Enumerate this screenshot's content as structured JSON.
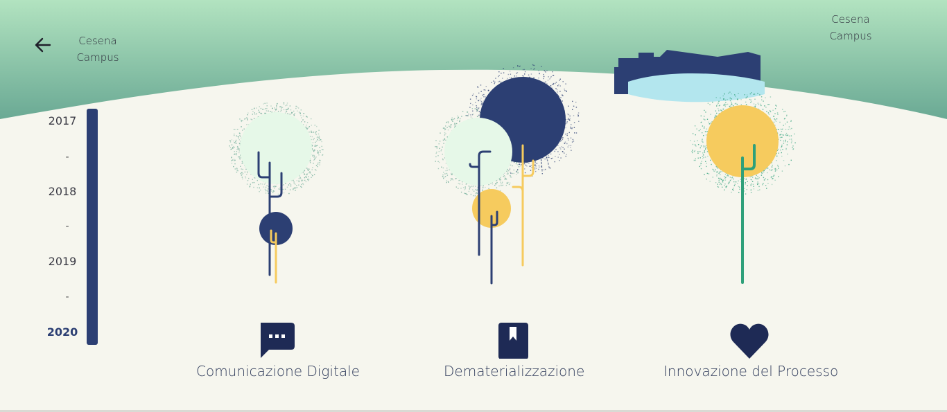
{
  "header": {
    "back_icon": "arrow-left-icon",
    "campus_left": {
      "line1": "Cesena",
      "line2": "Campus"
    },
    "campus_right": {
      "line1": "Cesena",
      "line2": "Campus"
    }
  },
  "timeline": {
    "years": [
      "2017",
      "2018",
      "2019",
      "2020"
    ],
    "separator": "-",
    "active_year": "2020"
  },
  "categories": [
    {
      "label": "Comunicazione Digitale",
      "icon": "chat-bubble-icon"
    },
    {
      "label": "Dematerializzazione",
      "icon": "bookmark-book-icon"
    },
    {
      "label": "Innovazione del Processo",
      "icon": "heart-icon"
    }
  ],
  "colors": {
    "navy": "#2c3f73",
    "dark_navy": "#1e2a55",
    "yellow": "#f6cb5e",
    "mint": "#e6f8e8",
    "green": "#2fa07a",
    "sky_top": "#b2e3c0",
    "sky_bottom": "#6aa994",
    "water": "#b3e6ee",
    "background": "#f6f6ee"
  }
}
